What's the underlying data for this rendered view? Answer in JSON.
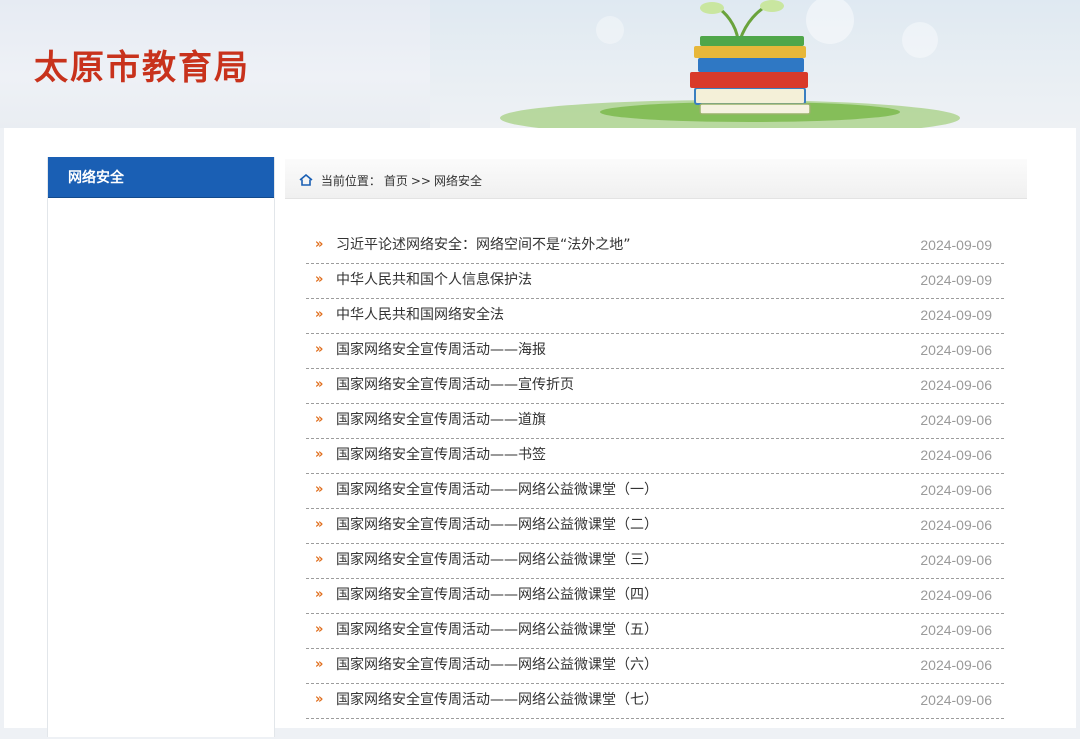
{
  "header": {
    "site_title": "太原市教育局"
  },
  "sidebar": {
    "title": "网络安全"
  },
  "breadcrumb": {
    "prefix": "当前位置：",
    "home": "首页",
    "separator": ">>",
    "current": "网络安全"
  },
  "articles": [
    {
      "title": "习近平论述网络安全：网络空间不是“法外之地”",
      "date": "2024-09-09"
    },
    {
      "title": "中华人民共和国个人信息保护法",
      "date": "2024-09-09"
    },
    {
      "title": "中华人民共和国网络安全法",
      "date": "2024-09-09"
    },
    {
      "title": "国家网络安全宣传周活动——海报",
      "date": "2024-09-06"
    },
    {
      "title": "国家网络安全宣传周活动——宣传折页",
      "date": "2024-09-06"
    },
    {
      "title": "国家网络安全宣传周活动——道旗",
      "date": "2024-09-06"
    },
    {
      "title": "国家网络安全宣传周活动——书签",
      "date": "2024-09-06"
    },
    {
      "title": "国家网络安全宣传周活动——网络公益微课堂（一）",
      "date": "2024-09-06"
    },
    {
      "title": "国家网络安全宣传周活动——网络公益微课堂（二）",
      "date": "2024-09-06"
    },
    {
      "title": "国家网络安全宣传周活动——网络公益微课堂（三）",
      "date": "2024-09-06"
    },
    {
      "title": "国家网络安全宣传周活动——网络公益微课堂（四）",
      "date": "2024-09-06"
    },
    {
      "title": "国家网络安全宣传周活动——网络公益微课堂（五）",
      "date": "2024-09-06"
    },
    {
      "title": "国家网络安全宣传周活动——网络公益微课堂（六）",
      "date": "2024-09-06"
    },
    {
      "title": "国家网络安全宣传周活动——网络公益微课堂（七）",
      "date": "2024-09-06"
    }
  ],
  "list_marker": "»",
  "colors": {
    "title_red": "#c8321c",
    "sidebar_blue": "#1a5fb4",
    "arrow_orange": "#e07020",
    "date_gray": "#9a9a9a"
  }
}
